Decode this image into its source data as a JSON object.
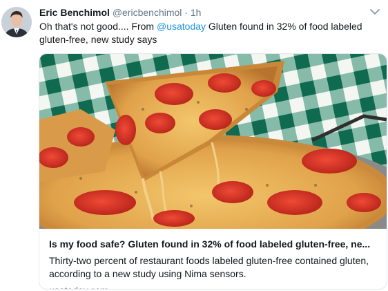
{
  "tweet": {
    "author_name": "Eric Benchimol",
    "handle": "@ericbenchimol",
    "separator": "·",
    "time": "1h",
    "text_before": "Oh that's not good.... From ",
    "mention": "@usatoday",
    "text_after": " Gluten found in 32% of food labeled gluten-free, new study says"
  },
  "icons": {
    "menu": "chevron-down-icon",
    "avatar": "profile-photo"
  },
  "card": {
    "image": "pizza-photo",
    "title": "Is my food safe? Gluten found in 32% of food labeled gluten-free, ne...",
    "description": "Thirty-two percent of restaurant foods labeled gluten-free contained gluten, according to a new study using Nima sensors.",
    "domain": "usatoday.com"
  },
  "colors": {
    "link": "#1b95e0",
    "muted": "#657786",
    "text": "#14171a"
  }
}
